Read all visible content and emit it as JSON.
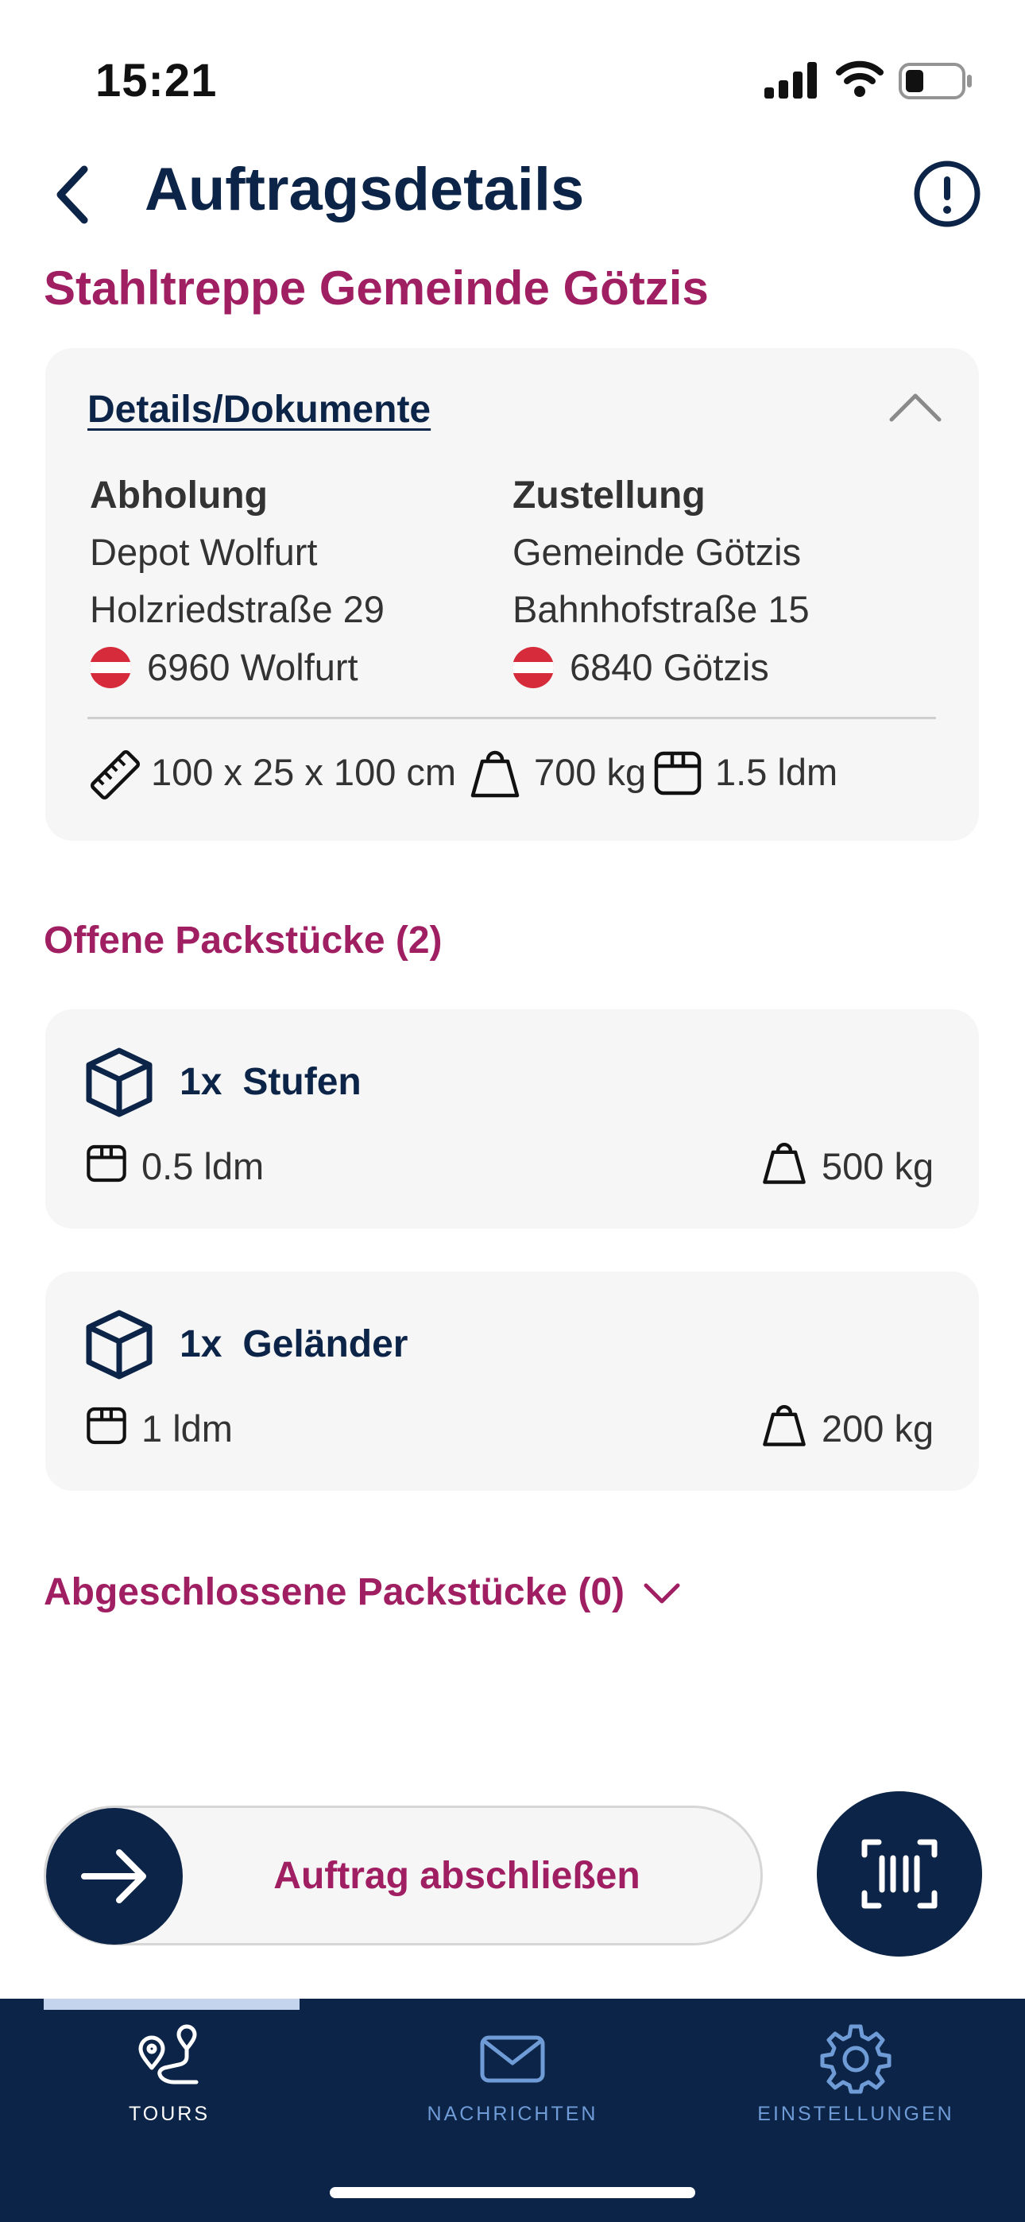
{
  "status_bar": {
    "time": "15:21"
  },
  "header": {
    "title": "Auftragsdetails"
  },
  "order": {
    "title": "Stahltreppe Gemeinde Götzis"
  },
  "details": {
    "link_label": "Details/Dokumente",
    "pickup": {
      "heading": "Abholung",
      "name": "Depot Wolfurt",
      "street": "Holzriedstraße 29",
      "city": "6960 Wolfurt"
    },
    "delivery": {
      "heading": "Zustellung",
      "name": "Gemeinde Götzis",
      "street": "Bahnhofstraße 15",
      "city": "6840 Götzis"
    },
    "dimensions": "100 x 25 x 100 cm",
    "weight": "700 kg",
    "loading_meters": "1.5 ldm"
  },
  "open_packages": {
    "heading": "Offene Packstücke (2)",
    "items": [
      {
        "qty": "1x",
        "name": "Stufen",
        "ldm": "0.5 ldm",
        "weight": "500 kg"
      },
      {
        "qty": "1x",
        "name": "Geländer",
        "ldm": "1 ldm",
        "weight": "200 kg"
      }
    ]
  },
  "closed_packages": {
    "heading": "Abgeschlossene Packstücke (0)"
  },
  "action": {
    "complete_label": "Auftrag abschließen"
  },
  "tabs": [
    {
      "label": "TOURS",
      "icon": "route-icon",
      "active": true
    },
    {
      "label": "NACHRICHTEN",
      "icon": "mail-icon",
      "active": false
    },
    {
      "label": "EINSTELLUNGEN",
      "icon": "gear-icon",
      "active": false
    }
  ],
  "colors": {
    "brand_navy": "#0c2447",
    "accent_magenta": "#a01f62",
    "card_bg": "#f6f6f6",
    "tab_inactive": "#6f9bd6",
    "austria_red": "#d52b3a"
  }
}
